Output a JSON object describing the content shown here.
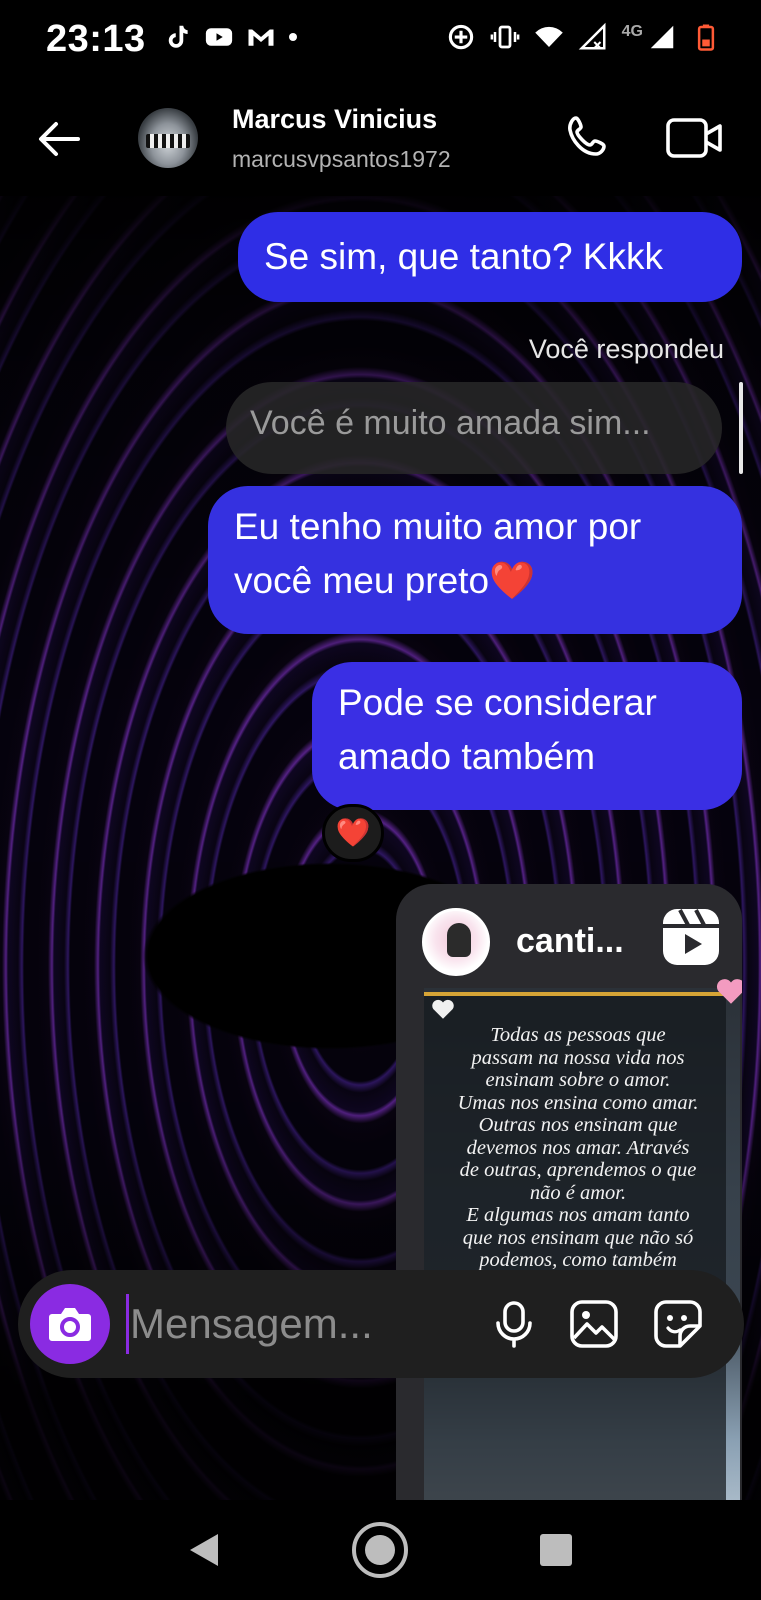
{
  "status_bar": {
    "time": "23:13",
    "network_label": "4G",
    "left_icons": [
      "tiktok-icon",
      "youtube-icon",
      "gmail-icon",
      "dot-icon"
    ],
    "right_icons": [
      "data-saver-icon",
      "vibrate-icon",
      "wifi-icon",
      "signal-icon",
      "signal-icon",
      "battery-low-icon"
    ]
  },
  "header": {
    "contact_name": "Marcus Vinicius",
    "username": "marcusvpsantos1972",
    "actions": [
      "phone-icon",
      "video-camera-icon"
    ]
  },
  "messages": {
    "m1": "Se sim, que tanto? Kkkk",
    "reply_label": "Você respondeu",
    "reply_quote": "Você é muito amada sim...",
    "m2": "Eu tenho muito amor por você meu preto❤️",
    "m3": "Pode se considerar amado também",
    "reaction": "❤️"
  },
  "shared_reel": {
    "username": "canti...",
    "text": "Todas as pessoas que\npassam na nossa vida nos\nensinam  sobre o amor.\nUmas nos ensina como amar.\nOutras nos ensinam que\ndevemos nos amar. Através\nde outras, aprendemos o que\nnão é amor.\nE  algumas nos amam tanto\nque nos ensinam que não só\npodemos, como também\ndevemos ser amados"
  },
  "composer": {
    "placeholder": "Mensagem..."
  },
  "colors": {
    "outgoing_bubble": "#3531e0",
    "accent_purple": "#8a2be2",
    "background": "#000000"
  }
}
